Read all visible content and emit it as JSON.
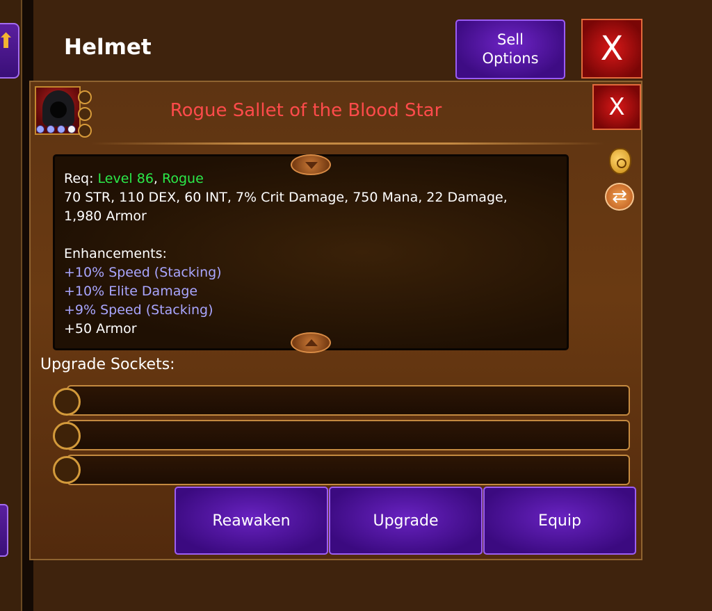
{
  "header": {
    "title": "Helmet",
    "sell_options_label": "Sell\nOptions",
    "close_label": "X"
  },
  "item": {
    "name": "Rogue Sallet of the Blood Star",
    "close_label": "X",
    "name_color": "#ff4b4b"
  },
  "stats": {
    "req_prefix": "Req: ",
    "req_level": "Level 86",
    "req_sep": ", ",
    "req_class": "Rogue",
    "line1": "70 STR, 110 DEX, 60 INT, 7% Crit Damage, 750 Mana, 22 Damage,",
    "line2": "1,980 Armor",
    "enhancements_label": "Enhancements:",
    "enhancements": [
      "+10% Speed (Stacking)",
      "+10% Elite Damage",
      "+9% Speed (Stacking)",
      "+50 Armor"
    ]
  },
  "sockets": {
    "label": "Upgrade Sockets:"
  },
  "actions": {
    "reawaken": "Reawaken",
    "upgrade": "Upgrade",
    "equip": "Equip"
  },
  "colors": {
    "accent_purple": "#5a1f9e",
    "close_red": "#d81818",
    "req_green": "#2bea4a",
    "enhancement_blue": "#a9a6ff"
  },
  "icons": [
    "up-arrow-icon",
    "hooded-rogue-icon",
    "gold-bag-icon",
    "swap-icon",
    "close-icon"
  ]
}
